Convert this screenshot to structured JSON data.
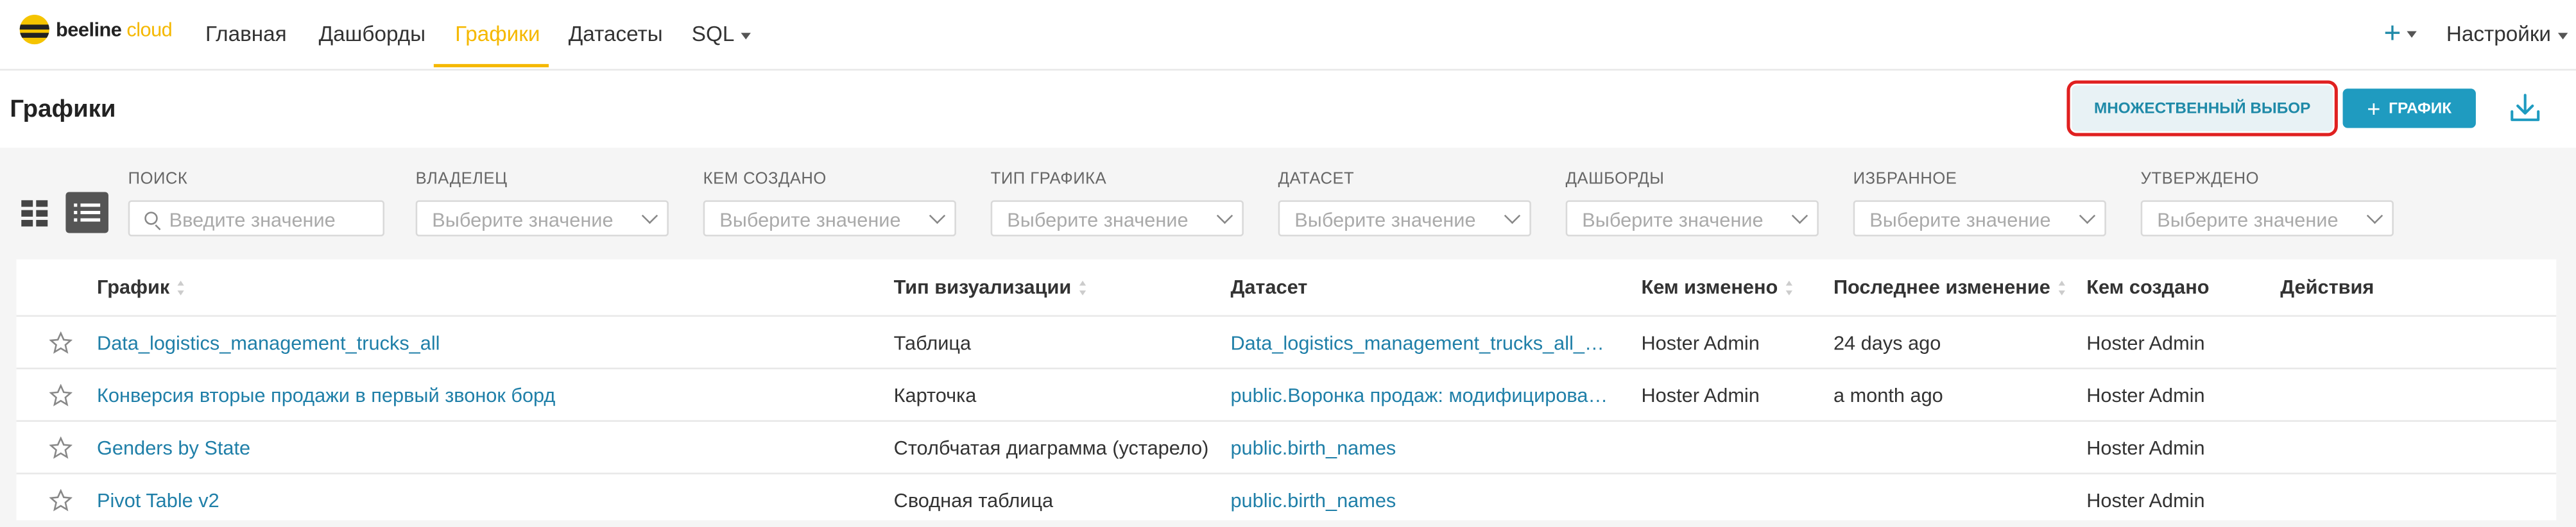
{
  "brand": {
    "name_part1": "beeline",
    "name_part2": "cloud"
  },
  "nav": {
    "items": [
      {
        "label": "Главная"
      },
      {
        "label": "Дашборды"
      },
      {
        "label": "Графики"
      },
      {
        "label": "Датасеты"
      },
      {
        "label": "SQL"
      }
    ],
    "active": "Графики",
    "plus_label": "+",
    "settings_label": "Настройки"
  },
  "header": {
    "title": "Графики",
    "bulk_select_label": "МНОЖЕСТВЕННЫЙ ВЫБОР",
    "add_chart_label": "ГРАФИК",
    "add_chart_plus": "+"
  },
  "filters": [
    {
      "label": "ПОИСК",
      "placeholder": "Введите значение"
    },
    {
      "label": "ВЛАДЕЛЕЦ",
      "placeholder": "Выберите значение"
    },
    {
      "label": "КЕМ СОЗДАНО",
      "placeholder": "Выберите значение"
    },
    {
      "label": "ТИП ГРАФИКА",
      "placeholder": "Выберите значение"
    },
    {
      "label": "ДАТАСЕТ",
      "placeholder": "Выберите значение"
    },
    {
      "label": "ДАШБОРДЫ",
      "placeholder": "Выберите значение"
    },
    {
      "label": "ИЗБРАННОЕ",
      "placeholder": "Выберите значение"
    },
    {
      "label": "УТВЕРЖДЕНО",
      "placeholder": "Выберите значение"
    }
  ],
  "table": {
    "columns": [
      "График",
      "Тип визуализации",
      "Датасет",
      "Кем изменено",
      "Последнее изменение",
      "Кем создано",
      "Действия"
    ],
    "rows": [
      {
        "chart": "Data_logistics_management_trucks_all",
        "viz_type": "Таблица",
        "dataset": "Data_logistics_management_trucks_all_pav",
        "modified_by": "Hoster Admin",
        "last_modified": "24 days ago",
        "created_by": "Hoster Admin"
      },
      {
        "chart": "Конверсия вторые продажи в первый звонок борд",
        "viz_type": "Карточка",
        "dataset": "public.Воронка продаж: модифицированн…",
        "modified_by": "Hoster Admin",
        "last_modified": "a month ago",
        "created_by": "Hoster Admin"
      },
      {
        "chart": "Genders by State",
        "viz_type": "Столбчатая диаграмма (устарело)",
        "dataset": "public.birth_names",
        "modified_by": "",
        "last_modified": "",
        "created_by": "Hoster Admin"
      },
      {
        "chart": "Pivot Table v2",
        "viz_type": "Сводная таблица",
        "dataset": "public.birth_names",
        "modified_by": "",
        "last_modified": "",
        "created_by": "Hoster Admin"
      }
    ]
  },
  "colors": {
    "accent": "#f5b800",
    "primary": "#1f9bc0",
    "link": "#1f7fa8",
    "highlight_border": "#e02020"
  }
}
